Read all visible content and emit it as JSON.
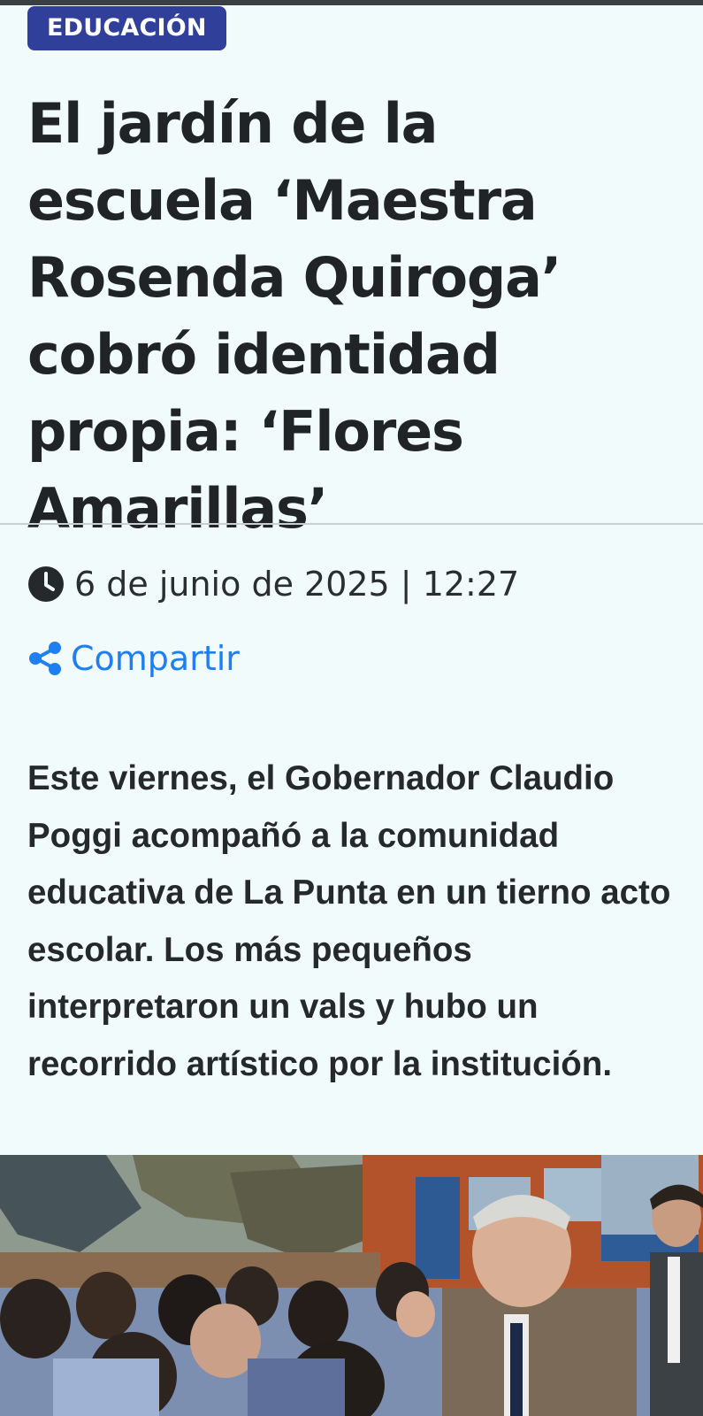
{
  "article": {
    "category": "EDUCACIÓN",
    "headline": "El jardín de la escuela ‘Maestra Rosenda Quiroga’ cobró identidad propia: ‘Flores Amarillas’",
    "datetime": "6 de junio de 2025 | 12:27",
    "share_label": "Compartir",
    "lede": "Este viernes, el Gobernador Claudio Poggi acompañó a la comunidad educativa de La Punta en un tierno acto escolar. Los más pequeños interpretaron un vals y hubo un recorrido artístico por la institución."
  },
  "icons": {
    "clock": "clock-icon",
    "share": "share-icon"
  },
  "colors": {
    "background": "#f1fbfb",
    "badge": "#2f3f9a",
    "link": "#1f7ff0",
    "text": "#202427"
  }
}
